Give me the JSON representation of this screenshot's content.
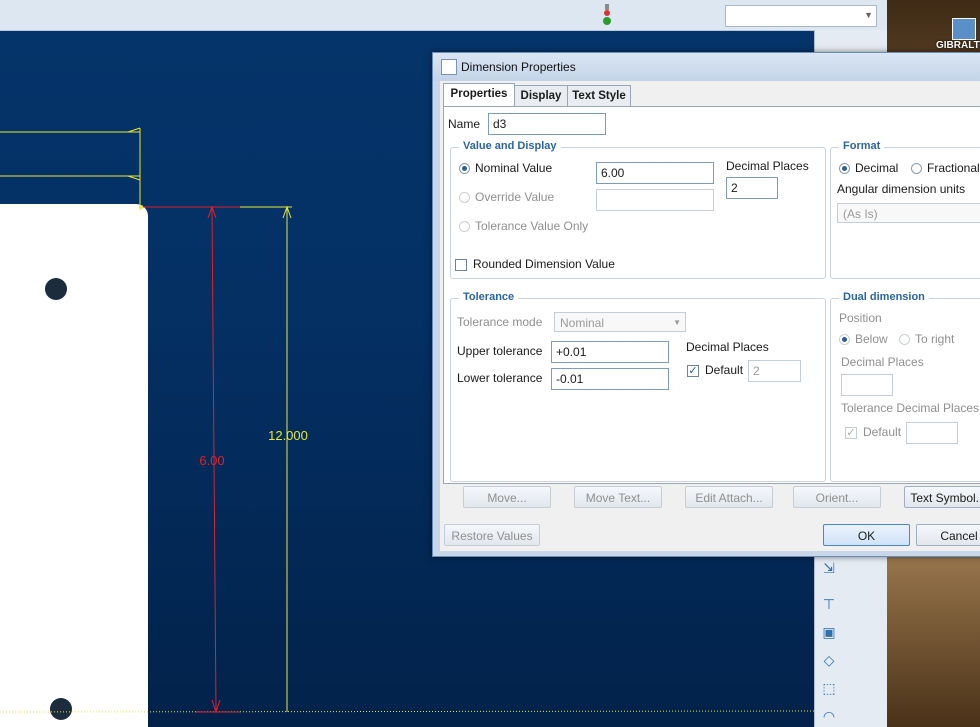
{
  "dialog": {
    "title": "Dimension Properties",
    "tabs": [
      "Properties",
      "Display",
      "Text Style"
    ],
    "name_label": "Name",
    "name_value": "d3",
    "value_display": {
      "title": "Value and Display",
      "nominal_label": "Nominal Value",
      "nominal_value": "6.00",
      "override_label": "Override Value",
      "override_value": "",
      "tol_only_label": "Tolerance Value Only",
      "decimal_label": "Decimal Places",
      "decimal_value": "2",
      "rounded_label": "Rounded Dimension Value"
    },
    "format": {
      "title": "Format",
      "decimal_label": "Decimal",
      "fractional_label": "Fractional",
      "angular_label": "Angular dimension units",
      "angular_value": "(As Is)"
    },
    "tolerance": {
      "title": "Tolerance",
      "mode_label": "Tolerance mode",
      "mode_value": "Nominal",
      "upper_label": "Upper tolerance",
      "upper_value": "+0.01",
      "lower_label": "Lower tolerance",
      "lower_value": "-0.01",
      "decimal_label": "Decimal Places",
      "default_label": "Default",
      "default_value": "2"
    },
    "dual": {
      "title": "Dual dimension",
      "position_label": "Position",
      "below_label": "Below",
      "right_label": "To right",
      "decimal_label": "Decimal Places",
      "tol_decimal_label": "Tolerance Decimal Places",
      "default_label": "Default"
    },
    "buttons": {
      "move": "Move...",
      "move_text": "Move Text...",
      "edit_attach": "Edit Attach...",
      "orient": "Orient...",
      "text_symbol": "Text Symbol...",
      "restore": "Restore Values",
      "ok": "OK",
      "cancel": "Cancel"
    }
  },
  "drawing": {
    "dim_selected": "6.00",
    "dim_other": "12.000",
    "selected_color": "#e0202a",
    "dim_color": "#e8e830"
  },
  "desktop": {
    "shortcut_label": "GIBRALT"
  }
}
